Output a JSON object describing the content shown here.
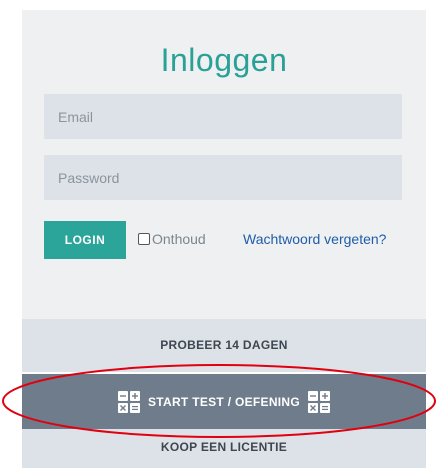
{
  "login": {
    "title": "Inloggen",
    "email_placeholder": "Email",
    "password_placeholder": "Password",
    "login_label": "LOGIN",
    "remember_label": "Onthoud",
    "forgot_label": "Wachtwoord vergeten?"
  },
  "actions": {
    "trial_label": "PROBEER 14 DAGEN",
    "start_label": "START TEST / OEFENING",
    "buy_label": "KOOP EEN LICENTIE"
  },
  "colors": {
    "accent": "#2aa196",
    "start_bar": "#6e7c8b",
    "highlight_ellipse": "#e0000f"
  },
  "icons": [
    "calculator-icon",
    "calculator-icon"
  ]
}
